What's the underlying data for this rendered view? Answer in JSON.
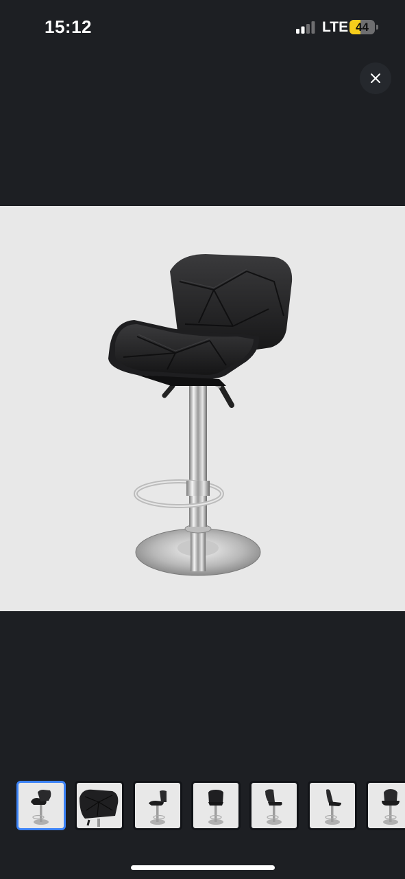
{
  "status_bar": {
    "time": "15:12",
    "network": "LTE",
    "battery_level": "44",
    "battery_percent": 44,
    "battery_color": "#f7ce1b",
    "signal_bars_active": 2,
    "signal_bars_total": 4
  },
  "viewer": {
    "close_icon": "close-icon",
    "main_image_subject": "bar-stool-product-photo",
    "background_color": "#1d1f23",
    "image_background": "#e8e8e8"
  },
  "thumbnails": {
    "selected_index": 0,
    "selected_color": "#3b82f6",
    "items": [
      {
        "view": "front-three-quarter"
      },
      {
        "view": "seat-close-up"
      },
      {
        "view": "side-left"
      },
      {
        "view": "back"
      },
      {
        "view": "side-right"
      },
      {
        "view": "side-profile"
      },
      {
        "view": "front"
      }
    ]
  }
}
